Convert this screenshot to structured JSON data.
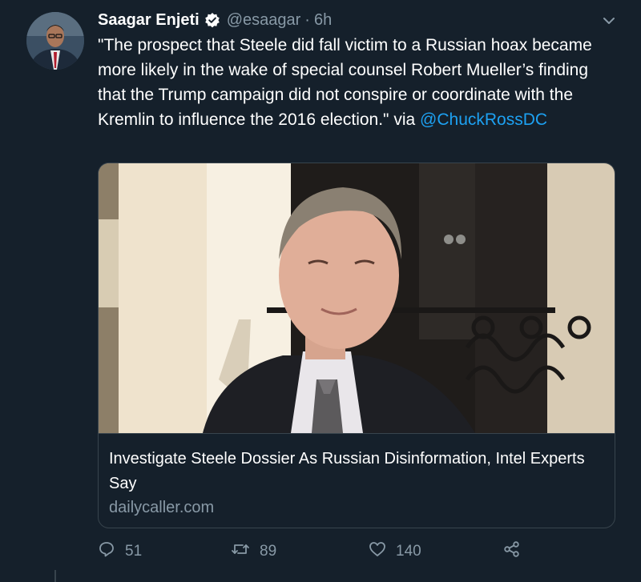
{
  "tweet": {
    "author_name": "Saagar Enjeti",
    "handle": "@esaagar",
    "separator": "·",
    "time": "6h",
    "text": "\"The prospect that Steele did fall victim to a Russian hoax became more likely in the wake of special counsel Robert Mueller’s finding that the Trump campaign did not conspire or coordinate with the Kremlin to influence the 2016 election.\" via ",
    "mention": "@ChuckRossDC"
  },
  "card": {
    "title": "Investigate Steele Dossier As Russian Disinformation, Intel Experts Say",
    "domain": "dailycaller.com"
  },
  "actions": {
    "replies": "51",
    "retweets": "89",
    "likes": "140"
  },
  "colors": {
    "background": "#15202b",
    "accent": "#1da1f2",
    "secondary_text": "#8899a6",
    "border": "#38444d"
  },
  "icons": [
    "verified-badge-icon",
    "chevron-down-icon",
    "reply-icon",
    "retweet-icon",
    "like-icon",
    "share-icon"
  ]
}
